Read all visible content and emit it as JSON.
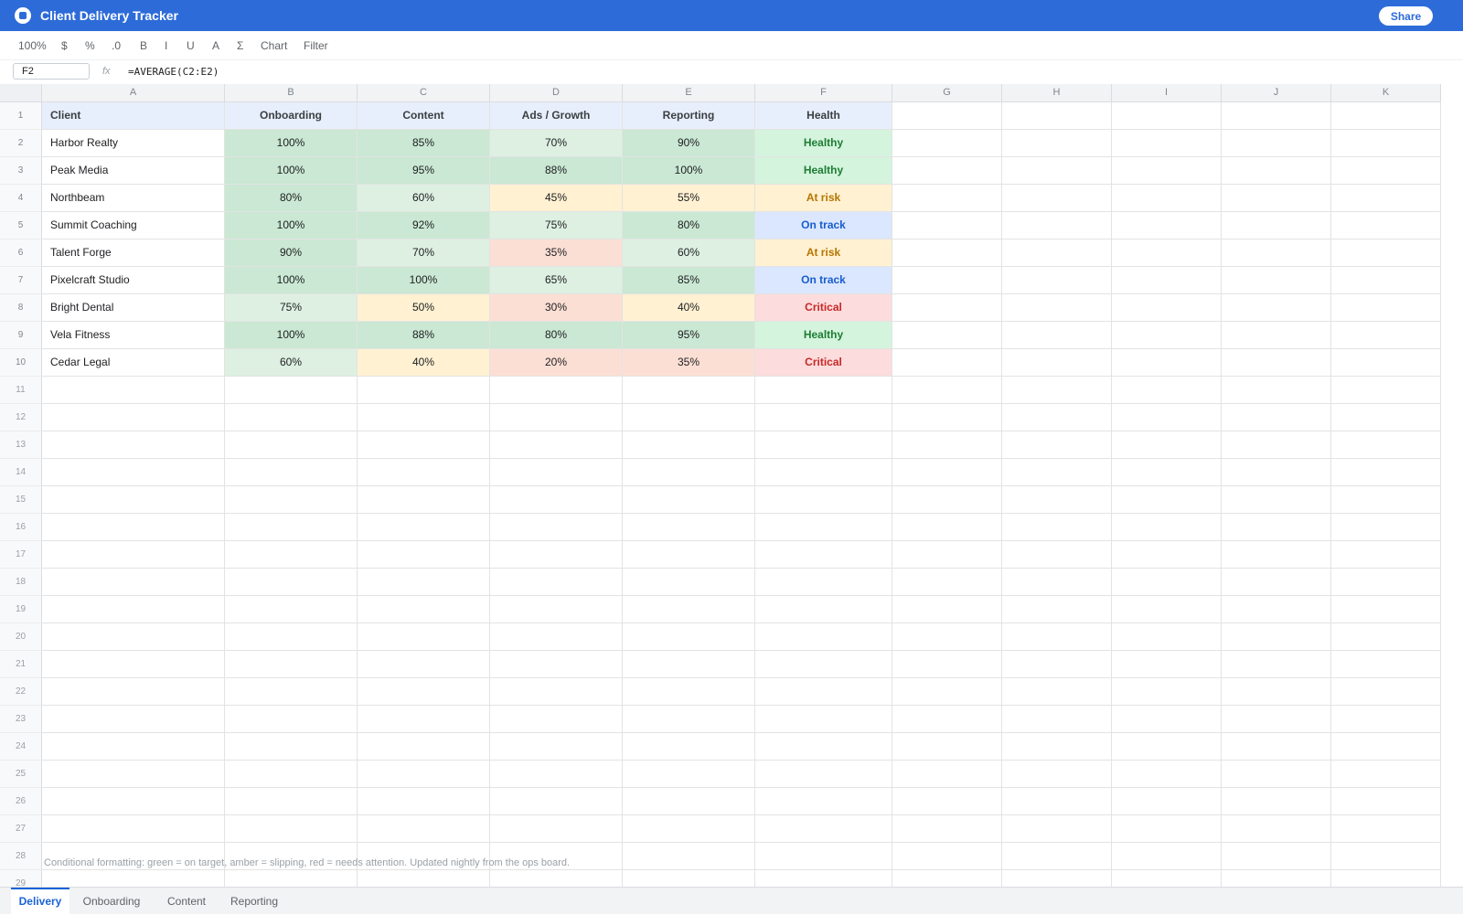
{
  "app": {
    "title": "Client Delivery Tracker",
    "share_label": "Share"
  },
  "toolbar": {
    "items": [
      "100%",
      "$",
      "%",
      ".0",
      "B",
      "I",
      "U",
      "A",
      "Σ",
      "Chart",
      "Filter"
    ]
  },
  "formula_bar": {
    "cell_ref": "F2",
    "fx_label": "fx",
    "formula": "=AVERAGE(C2:E2)"
  },
  "grid": {
    "columns": [
      "A",
      "B",
      "C",
      "D",
      "E",
      "F",
      "G",
      "H",
      "I",
      "J",
      "K"
    ],
    "headers": [
      "Client",
      "Onboarding",
      "Content",
      "Ads / Growth",
      "Reporting",
      "Health"
    ],
    "rows": [
      {
        "cells": [
          "Harbor Realty",
          "100%",
          "85%",
          "70%",
          "90%",
          "Healthy"
        ]
      },
      {
        "cells": [
          "Peak Media",
          "100%",
          "95%",
          "88%",
          "100%",
          "Healthy"
        ]
      },
      {
        "cells": [
          "Northbeam",
          "80%",
          "60%",
          "45%",
          "55%",
          "At risk"
        ]
      },
      {
        "cells": [
          "Summit Coaching",
          "100%",
          "92%",
          "75%",
          "80%",
          "On track"
        ]
      },
      {
        "cells": [
          "Talent Forge",
          "90%",
          "70%",
          "35%",
          "60%",
          "At risk"
        ]
      },
      {
        "cells": [
          "Pixelcraft Studio",
          "100%",
          "100%",
          "65%",
          "85%",
          "On track"
        ]
      },
      {
        "cells": [
          "Bright Dental",
          "75%",
          "50%",
          "30%",
          "40%",
          "Critical"
        ]
      },
      {
        "cells": [
          "Vela Fitness",
          "100%",
          "88%",
          "80%",
          "95%",
          "Healthy"
        ]
      },
      {
        "cells": [
          "Cedar Legal",
          "60%",
          "40%",
          "20%",
          "35%",
          "Critical"
        ]
      }
    ],
    "row_count": 29,
    "note": "Conditional formatting: green = on target, amber = slipping, red = needs attention. Updated nightly from the ops board."
  },
  "colors": {
    "header_bg": "#e8effc",
    "pct_high": "#cae8d3",
    "pct_mid": "#ddf0e2",
    "pct_amber": "#fff1d2",
    "pct_red": "#fcdfd4",
    "status": {
      "Healthy": {
        "bg": "#d4f4dd",
        "fg": "#1e7d34"
      },
      "On track": {
        "bg": "#dae7ff",
        "fg": "#1a5ccd"
      },
      "At risk": {
        "bg": "#fff1d2",
        "fg": "#b67500"
      },
      "Critical": {
        "bg": "#fcdcdc",
        "fg": "#c62828"
      }
    }
  },
  "sheet_tabs": [
    {
      "label": "Delivery",
      "active": true
    },
    {
      "label": "Onboarding",
      "active": false
    },
    {
      "label": "Content",
      "active": false
    },
    {
      "label": "Reporting",
      "active": false
    }
  ]
}
